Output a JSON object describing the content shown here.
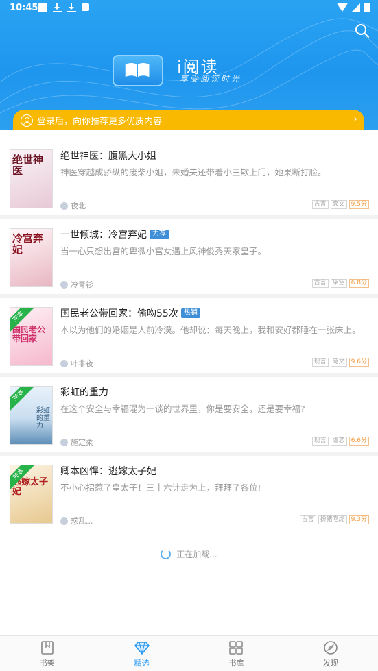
{
  "status_bar": {
    "time": "10:45"
  },
  "header": {
    "app_name": "i阅读",
    "slogan": "享受阅读时光",
    "login_prompt": "登录后，向你推荐更多优质内容"
  },
  "books": [
    {
      "title": "绝世神医：腹黑大小姐",
      "badge": "",
      "completed": false,
      "cover_text": "绝世神医",
      "cover_color": "#f2e6ee",
      "desc": "神医穿越成骄纵的废柴小姐，未婚夫还带着小三欺上门，她果断打脸。",
      "author": "夜北",
      "tags": [
        "古言",
        "爽文"
      ],
      "score": "9.5分"
    },
    {
      "title": "一世倾城：冷宫弃妃",
      "badge": "力荐",
      "completed": false,
      "cover_text": "冷宫弃妃",
      "cover_color": "#f4dde3",
      "desc": "当一心只想出宫的卑微小宫女遇上风神俊秀天家皇子。",
      "author": "冷青衫",
      "tags": [
        "古言",
        "架空"
      ],
      "score": "6.8分"
    },
    {
      "title": "国民老公带回家：偷吻55次",
      "badge": "热销",
      "completed": true,
      "cover_text": "国民老公带回家",
      "cover_color": "#fbe3ea",
      "desc": "本以为他们的婚姻是人前冷漠。他却说：每天晚上，我和安好都睡在一张床上。",
      "author": "叶非夜",
      "tags": [
        "现言",
        "宠文"
      ],
      "score": "9.6分"
    },
    {
      "title": "彩虹的重力",
      "badge": "",
      "completed": true,
      "cover_text": "彩虹的重力",
      "cover_color": "#cfe4f3",
      "desc": "在这个安全与幸福混为一谈的世界里，你是要安全，还是要幸福?",
      "author": "施定柔",
      "tags": [
        "现言",
        "虐恋"
      ],
      "score": "6.6分"
    },
    {
      "title": "卿本凶悍：逃嫁太子妃",
      "badge": "",
      "completed": true,
      "cover_text": "逃嫁太子妃",
      "cover_color": "#f7ead2",
      "desc": "不小心招惹了皇太子！三十六计走为上，拜拜了各位!",
      "author": "惑乱...",
      "tags": [
        "古言",
        "扮猪吃虎"
      ],
      "score": "9.3分"
    }
  ],
  "completed_label": "完本",
  "loading_text": "正在加载...",
  "nav": [
    {
      "label": "书架",
      "icon": "bookshelf-icon",
      "active": false
    },
    {
      "label": "精选",
      "icon": "diamond-icon",
      "active": true
    },
    {
      "label": "书库",
      "icon": "grid-icon",
      "active": false
    },
    {
      "label": "发现",
      "icon": "compass-icon",
      "active": false
    }
  ],
  "colors": {
    "primary": "#2a9af0",
    "banner": "#f9b900",
    "score": "#f39a3c"
  }
}
